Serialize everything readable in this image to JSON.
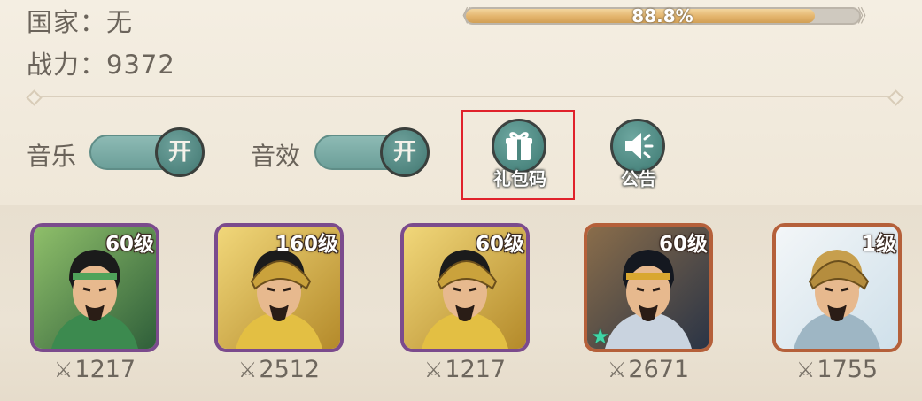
{
  "player": {
    "country": "国家：无",
    "power": "战力：9372"
  },
  "progress": {
    "percent_label": "88.8%",
    "fraction": 0.888
  },
  "settings": {
    "music_label": "音乐",
    "music_state": "开",
    "sfx_label": "音效",
    "sfx_state": "开"
  },
  "buttons": {
    "gift_code": "礼包码",
    "notice": "公告"
  },
  "heroes": [
    {
      "level": "60级",
      "power": "1217",
      "frame_color": "#7b4b8d",
      "theme": "green",
      "star": false
    },
    {
      "level": "160级",
      "power": "2512",
      "frame_color": "#7b4b8d",
      "theme": "gold",
      "star": false
    },
    {
      "level": "60级",
      "power": "1217",
      "frame_color": "#7b4b8d",
      "theme": "gold",
      "star": false
    },
    {
      "level": "60级",
      "power": "2671",
      "frame_color": "#b5603a",
      "theme": "blue",
      "star": true
    },
    {
      "level": "1级",
      "power": "1755",
      "frame_color": "#b5603a",
      "theme": "silver",
      "star": false
    }
  ],
  "colors": {
    "teal": "#5f968f",
    "highlight": "#e0222b",
    "bar_fill": "#e3b46c"
  },
  "icons": {
    "gift": "gift-icon",
    "speaker": "speaker-icon",
    "sword": "crossed-swords-icon",
    "star": "star-icon"
  }
}
